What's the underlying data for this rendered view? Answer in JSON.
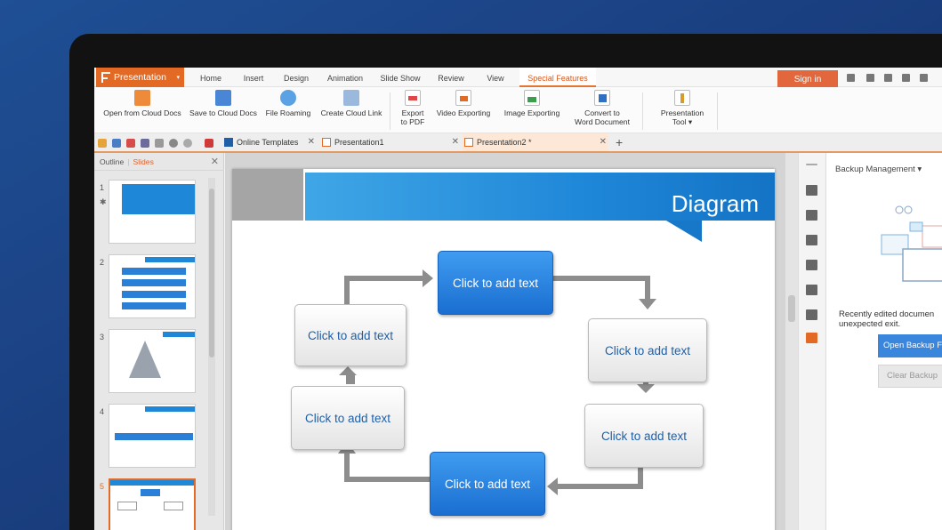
{
  "app": {
    "menu_label": "Presentation"
  },
  "ribbon_tabs": [
    "Home",
    "Insert",
    "Design",
    "Animation",
    "Slide Show",
    "Review",
    "View",
    "Special Features"
  ],
  "active_ribbon_tab": "Special Features",
  "header_right": {
    "sign_in": "Sign in"
  },
  "toolbar": {
    "open_cloud": "Open from Cloud Docs",
    "save_cloud": "Save to Cloud Docs",
    "file_roaming": "File Roaming",
    "create_cloud_link": "Create Cloud Link",
    "export_pdf_1": "Export",
    "export_pdf_2": "to PDF",
    "video_exporting": "Video Exporting",
    "image_exporting": "Image Exporting",
    "convert_word_1": "Convert to",
    "convert_word_2": "Word Document",
    "presentation_tool_1": "Presentation",
    "presentation_tool_2": "Tool ▾"
  },
  "doc_tabs": [
    {
      "label": "Online Templates"
    },
    {
      "label": "Presentation1"
    },
    {
      "label": "Presentation2 *"
    }
  ],
  "left_panel": {
    "outline": "Outline",
    "slides": "Slides",
    "separator": "|",
    "thumbnails": [
      "1",
      "2",
      "3",
      "4",
      "5"
    ]
  },
  "slide": {
    "title": "Diagram",
    "boxes": {
      "top": "Click to add text",
      "upper_left": "Click to add text",
      "upper_right": "Click to add text",
      "lower_left": "Click to add text",
      "lower_right": "Click to add text",
      "bottom": "Click to add text"
    }
  },
  "backup_panel": {
    "title": "Backup Management ▾",
    "message_1": "Recently edited documen",
    "message_2": "unexpected exit.",
    "open_button": "Open Backup F",
    "clear_button": "Clear Backup"
  },
  "colors": {
    "accent_orange": "#e36a25",
    "slide_blue": "#1f87d8",
    "desktop_blue": "#1a3f80"
  }
}
